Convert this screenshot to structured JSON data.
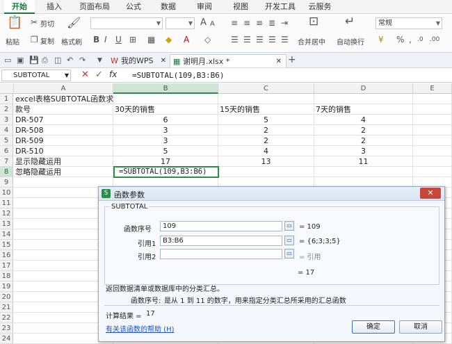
{
  "ribbon_tabs": [
    "开始",
    "插入",
    "页面布局",
    "公式",
    "数据",
    "审阅",
    "视图",
    "开发工具",
    "云服务"
  ],
  "ribbon": {
    "paste": "粘贴",
    "cut": "剪切",
    "copy": "复制",
    "format_painter": "格式刷",
    "bold": "B",
    "italic": "I",
    "underline": "U",
    "merge_center": "合并居中",
    "wrap_text": "自动换行",
    "number_format": "常规",
    "percent": "%",
    "thousands": ",",
    "font_grow": "A",
    "font_shrink": "A"
  },
  "doc_tabs": {
    "home": "我的WPS",
    "file": "谢明月.xlsx *",
    "add": "+"
  },
  "formula_bar": {
    "name_box": "SUBTOTAL",
    "cancel": "✕",
    "confirm": "✓",
    "fx": "fx",
    "formula": "=SUBTOTAL(109,B3:B6)"
  },
  "columns": [
    "A",
    "B",
    "C",
    "D",
    "E"
  ],
  "rows": [
    "1",
    "2",
    "3",
    "4",
    "5",
    "6",
    "7",
    "8",
    "9",
    "10",
    "11",
    "12",
    "13",
    "14",
    "15",
    "16",
    "17",
    "18",
    "19",
    "20",
    "21",
    "22",
    "23",
    "24"
  ],
  "cells": {
    "a1": "excel表格SUBTOTAL函数求",
    "a2": "款号",
    "b2": "30天的销售",
    "c2": "15天的销售",
    "d2": "7天的销售",
    "a3": "DR-507",
    "b3": "6",
    "c3": "5",
    "d3": "4",
    "a4": "DR-508",
    "b4": "3",
    "c4": "2",
    "d4": "2",
    "a5": "DR-509",
    "b5": "3",
    "c5": "2",
    "d5": "2",
    "a6": "DR-510",
    "b6": "5",
    "c6": "4",
    "d6": "3",
    "a7": "显示隐藏运用",
    "b7": "17",
    "c7": "13",
    "d7": "11",
    "a8": "忽略隐藏运用",
    "b8": "=SUBTOTAL(109,B3:B6)"
  },
  "dialog": {
    "title": "函数参数",
    "function_name": "SUBTOTAL",
    "arg1_label": "函数序号",
    "arg1_value": "109",
    "arg1_result": "= 109",
    "arg2_label": "引用1",
    "arg2_value": "B3:B6",
    "arg2_result": "= {6;3;3;5}",
    "arg3_label": "引用2",
    "arg3_value": "",
    "arg3_result": "= 引用",
    "total_result": "= 17",
    "description": "返回数据清单或数据库中的分类汇总。",
    "arg_desc_label": "函数序号:",
    "arg_desc": "是从 1 到 11 的数字，用来指定分类汇总所采用的汇总函数",
    "calc_label": "计算结果 =",
    "calc_value": "17",
    "help_link": "有关该函数的帮助 (H)",
    "ok": "确定",
    "cancel": "取消"
  },
  "colors": {
    "accent": "#1a7a3e",
    "selection": "#2e8b4b"
  }
}
